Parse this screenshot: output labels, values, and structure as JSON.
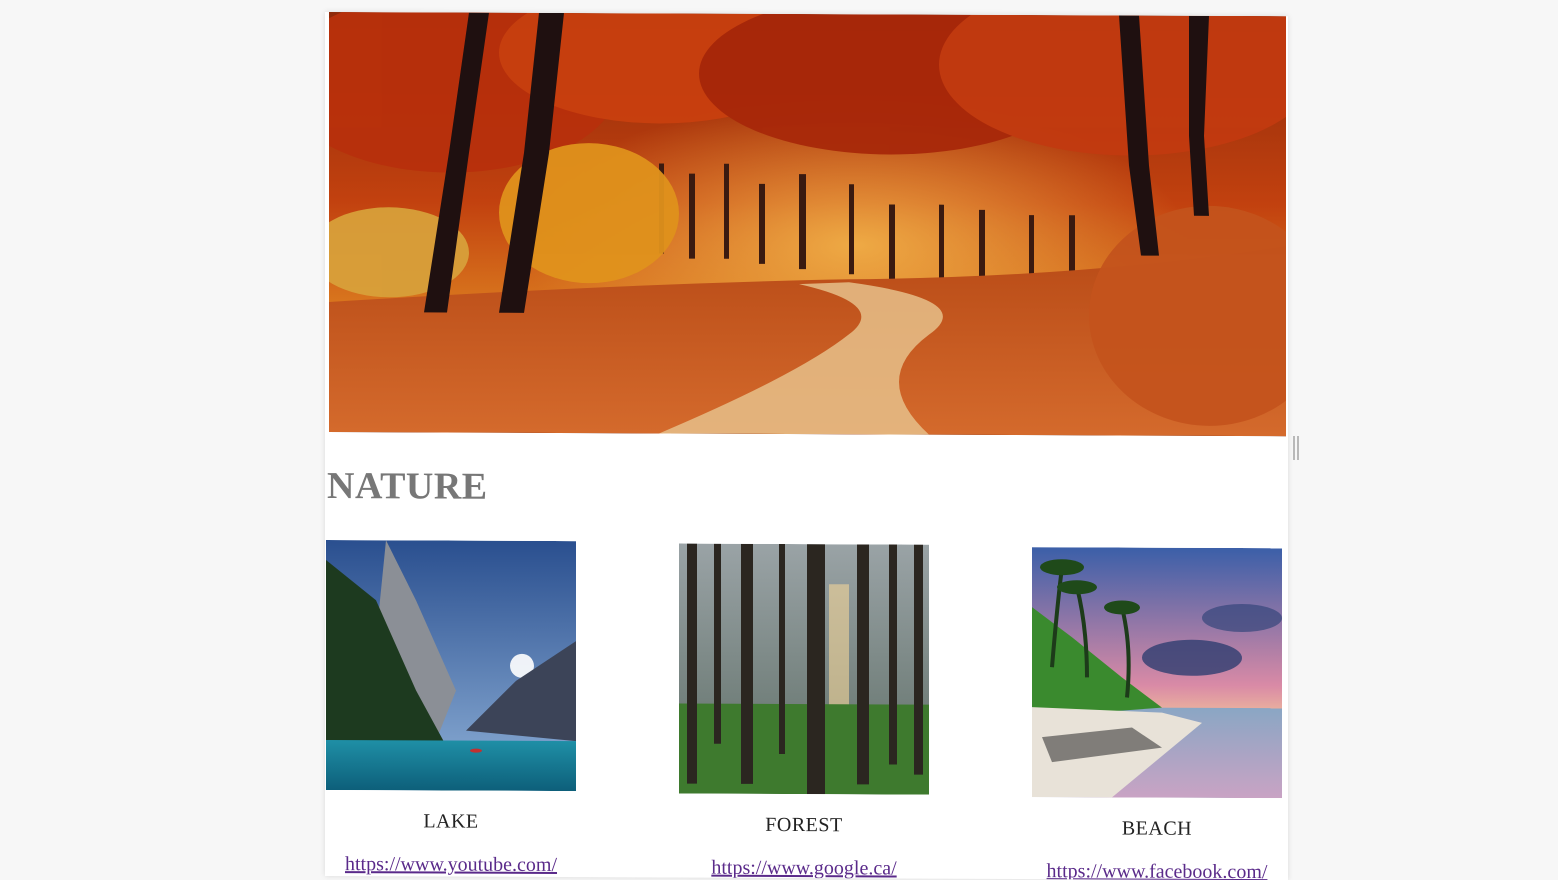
{
  "page": {
    "heading": "NATURE"
  },
  "cards": [
    {
      "label": "LAKE",
      "link": "https://www.youtube.com/"
    },
    {
      "label": "FOREST",
      "link": "https://www.google.ca/"
    },
    {
      "label": "BEACH",
      "link": "https://www.facebook.com/"
    }
  ],
  "images": {
    "hero": "autumn-forest-path-image",
    "lake": "mountain-lake-image",
    "forest": "misty-forest-image",
    "beach": "tropical-beach-sunset-image"
  },
  "colors": {
    "heading": "#777777",
    "link": "#5a2a8a",
    "background": "#f7f7f7"
  }
}
